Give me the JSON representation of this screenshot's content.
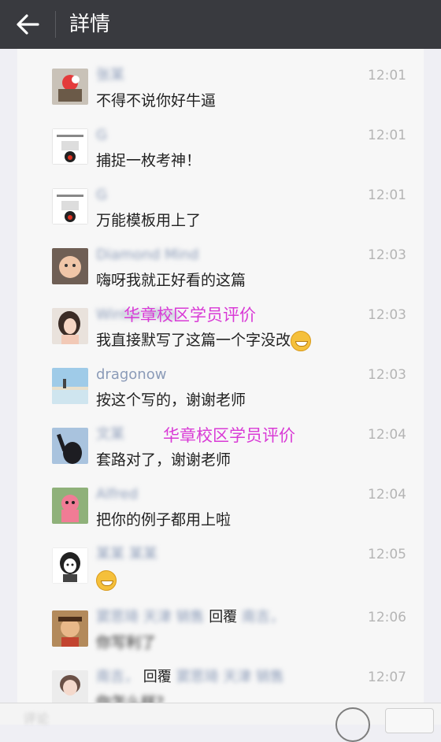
{
  "header": {
    "title": "詳情"
  },
  "watermark": {
    "text": "华章校区学员评价"
  },
  "comments": [
    {
      "name": "张某",
      "text": "不得不说你好牛逼",
      "time": "12:01"
    },
    {
      "name": "G",
      "text": "捕捉一枚考神！",
      "time": "12:01"
    },
    {
      "name": "G",
      "text": "万能模板用上了",
      "time": "12:01"
    },
    {
      "name": "Diamond Mind",
      "text": "嗨呀我就正好看的这篇",
      "time": "12:03"
    },
    {
      "name": "Winter Miss",
      "text": "我直接默写了这篇一个字没改",
      "time": "12:03"
    },
    {
      "name": "dragonow",
      "text": "按这个写的，谢谢老师",
      "time": "12:03"
    },
    {
      "name": "文某",
      "text": "套路对了，谢谢老师",
      "time": "12:04"
    },
    {
      "name": "Alfred",
      "text": "把你的例子都用上啦",
      "time": "12:04"
    },
    {
      "name": "某某 某某",
      "text": "",
      "time": "12:05"
    },
    {
      "name": "窦思琦 天津 销售",
      "reply_kw": "回覆",
      "reply_to": "南吉，",
      "text": "你写利了",
      "time": "12:06"
    },
    {
      "name": "南吉，",
      "reply_kw": "回覆",
      "reply_to": "窦思琦 天津 销售",
      "text": "你怎么样?",
      "time": "12:07"
    }
  ],
  "bottom": {
    "input_placeholder": "评论"
  }
}
